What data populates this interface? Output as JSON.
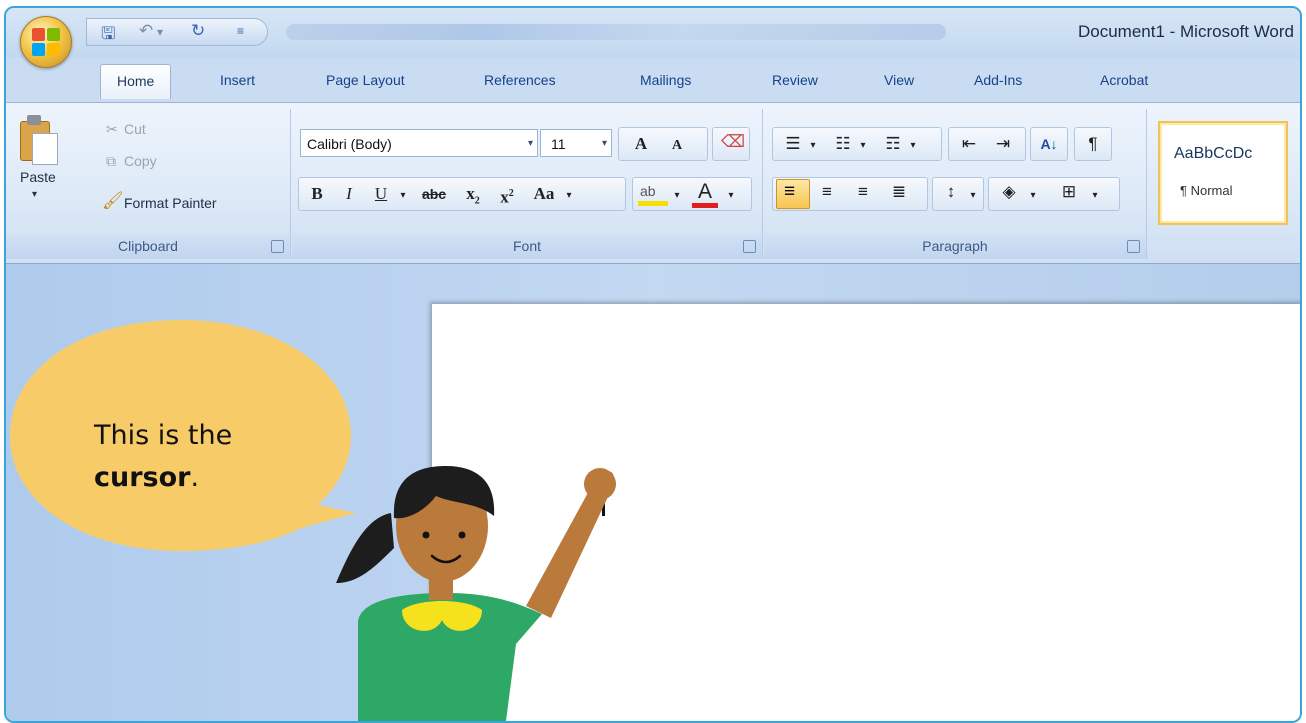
{
  "window": {
    "title": "Document1 - Microsoft Word"
  },
  "qat": {
    "save_icon": "save-icon",
    "undo_icon": "undo-icon",
    "redo_icon": "redo-icon"
  },
  "tabs": [
    {
      "label": "Home",
      "active": true
    },
    {
      "label": "Insert"
    },
    {
      "label": "Page Layout"
    },
    {
      "label": "References"
    },
    {
      "label": "Mailings"
    },
    {
      "label": "Review"
    },
    {
      "label": "View"
    },
    {
      "label": "Add-Ins"
    },
    {
      "label": "Acrobat"
    }
  ],
  "clipboard": {
    "paste_label": "Paste",
    "cut_label": "Cut",
    "copy_label": "Copy",
    "format_painter_label": "Format Painter",
    "group_label": "Clipboard"
  },
  "font": {
    "font_name": "Calibri (Body)",
    "font_size": "11",
    "grow_label": "A",
    "shrink_label": "A",
    "bold": "B",
    "italic": "I",
    "underline": "U",
    "strikethrough": "abc",
    "subscript": "x",
    "superscript": "x",
    "change_case": "Aa",
    "font_color_letter": "A",
    "group_label": "Font"
  },
  "paragraph": {
    "pilcrow": "¶",
    "group_label": "Paragraph"
  },
  "styles": {
    "sample": "AaBbCcDc",
    "name": "¶ Normal"
  },
  "callout": {
    "line1": "This is the",
    "bold_word": "cursor",
    "tail": "."
  },
  "colors": {
    "accent_border": "#3aa6d8",
    "bubble": "#f7cc68",
    "shirt": "#2ea866",
    "collar": "#f5e11c",
    "skin": "#b97a3c",
    "hair": "#1d1d1d",
    "highlight": "#f3e000",
    "font_color": "#e02020"
  }
}
